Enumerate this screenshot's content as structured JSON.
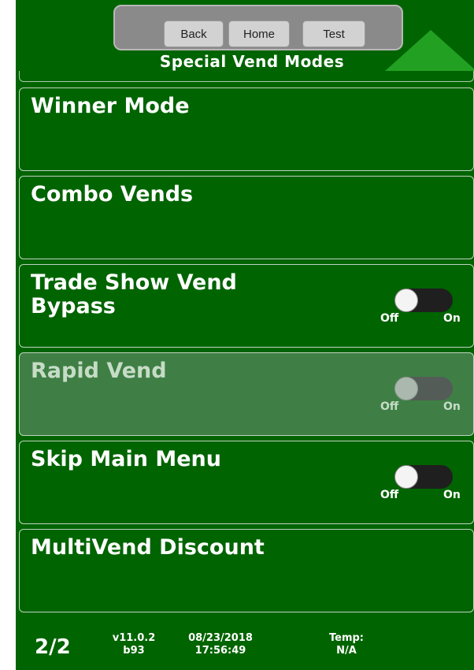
{
  "header": {
    "back_label": "Back",
    "home_label": "Home",
    "test_label": "Test",
    "title": "Special Vend Modes"
  },
  "rows": [
    {
      "label": "Winner Mode",
      "has_toggle": false
    },
    {
      "label": "Combo Vends",
      "has_toggle": false
    },
    {
      "label": "Trade Show Vend Bypass",
      "has_toggle": true,
      "toggle_state": "Off",
      "toggle_off_label": "Off",
      "toggle_on_label": "On"
    },
    {
      "label": "Rapid Vend",
      "has_toggle": true,
      "disabled": true,
      "toggle_state": "Off",
      "toggle_off_label": "Off",
      "toggle_on_label": "On"
    },
    {
      "label": "Skip Main Menu",
      "has_toggle": true,
      "toggle_state": "Off",
      "toggle_off_label": "Off",
      "toggle_on_label": "On"
    },
    {
      "label": "MultiVend Discount",
      "has_toggle": false
    }
  ],
  "footer": {
    "page": "2/2",
    "version": "v11.0.2",
    "build": "b93",
    "date": "08/23/2018",
    "time": "17:56:49",
    "temp_label": "Temp:",
    "temp_value": "N/A"
  },
  "colors": {
    "background": "#006400",
    "scroll_arrow": "#22a022",
    "disabled_row": "#3f7f45"
  },
  "icons": {
    "scroll_up": "triangle-up-icon"
  }
}
